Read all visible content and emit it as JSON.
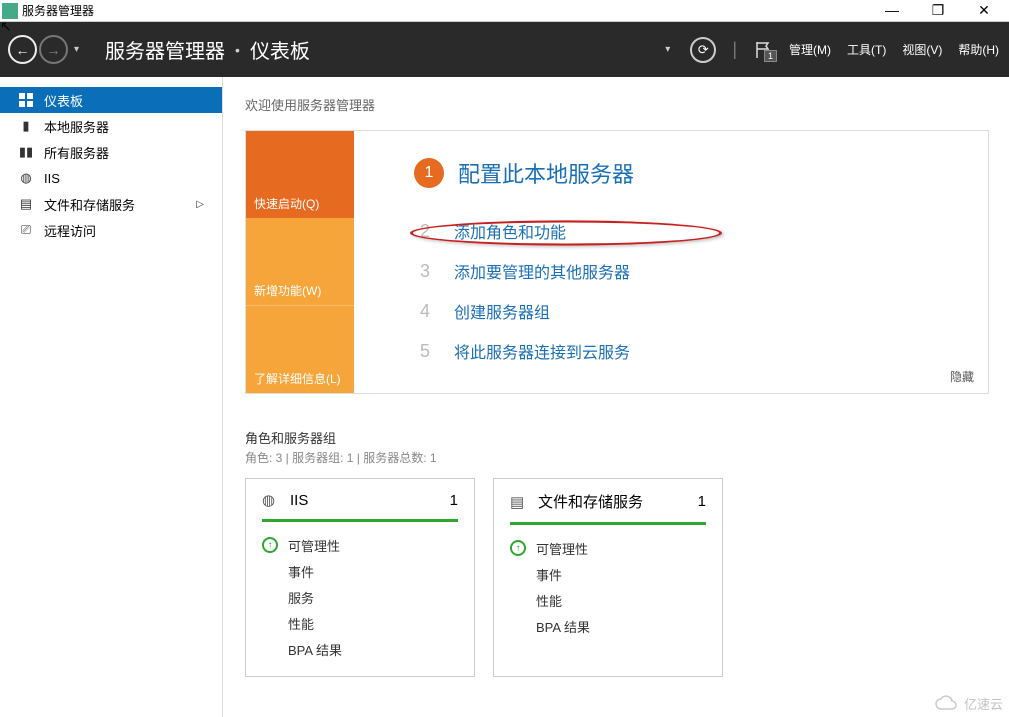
{
  "window": {
    "title": "服务器管理器"
  },
  "header": {
    "breadcrumb": [
      "服务器管理器",
      "仪表板"
    ],
    "menus": {
      "manage": "管理(M)",
      "tools": "工具(T)",
      "view": "视图(V)",
      "help": "帮助(H)"
    },
    "flag_badge": "1"
  },
  "sidebar": {
    "items": [
      {
        "label": "仪表板",
        "icon": "dashboard-icon",
        "active": true
      },
      {
        "label": "本地服务器",
        "icon": "server-icon"
      },
      {
        "label": "所有服务器",
        "icon": "servers-icon"
      },
      {
        "label": "IIS",
        "icon": "iis-icon"
      },
      {
        "label": "文件和存储服务",
        "icon": "storage-icon",
        "has_sub": true
      },
      {
        "label": "远程访问",
        "icon": "remote-icon"
      }
    ]
  },
  "welcome": {
    "heading": "欢迎使用服务器管理器",
    "tabs": [
      "快速启动(Q)",
      "新增功能(W)",
      "了解详细信息(L)"
    ],
    "lead_num": "1",
    "lead_text": "配置此本地服务器",
    "steps": [
      {
        "n": "2",
        "t": "添加角色和功能"
      },
      {
        "n": "3",
        "t": "添加要管理的其他服务器"
      },
      {
        "n": "4",
        "t": "创建服务器组"
      },
      {
        "n": "5",
        "t": "将此服务器连接到云服务"
      }
    ],
    "hide": "隐藏"
  },
  "roles": {
    "title": "角色和服务器组",
    "subtitle": "角色: 3 | 服务器组: 1 | 服务器总数: 1",
    "tiles": [
      {
        "name": "IIS",
        "count": "1",
        "rows": [
          "可管理性",
          "事件",
          "服务",
          "性能",
          "BPA 结果"
        ]
      },
      {
        "name": "文件和存储服务",
        "count": "1",
        "rows": [
          "可管理性",
          "事件",
          "性能",
          "BPA 结果"
        ]
      }
    ]
  },
  "watermark": "亿速云"
}
